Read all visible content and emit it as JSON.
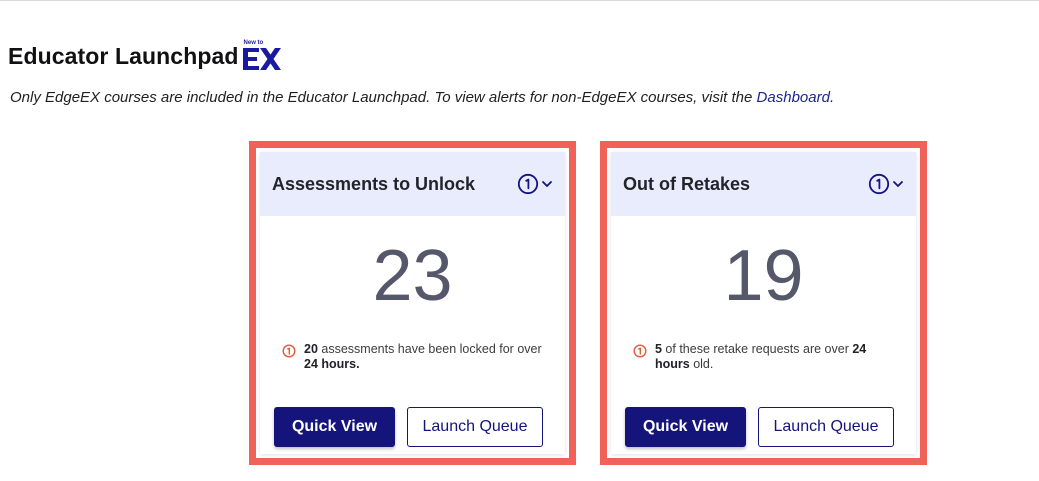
{
  "header": {
    "title": "Educator Launchpad",
    "logo": {
      "tag": "New to",
      "text": "EX",
      "color": "#1a1aa0",
      "icon": "edge-ex-logo-icon"
    }
  },
  "intro": {
    "text_before": "Only EdgeEX courses are included in the Educator Launchpad. To view alerts for non-EdgeEX courses, visit the ",
    "link_label": "Dashboard",
    "text_after": "."
  },
  "cards": [
    {
      "title": "Assessments to Unlock",
      "count": "23",
      "alert": {
        "highlight_count": "20",
        "text_mid": " assessments have been locked for over ",
        "highlight_time": "24 hours.",
        "text_end": ""
      },
      "primary_label": "Quick View",
      "secondary_label": "Launch Queue"
    },
    {
      "title": "Out of Retakes",
      "count": "19",
      "alert": {
        "highlight_count": "5",
        "text_mid": " of these retake requests are over ",
        "highlight_time": "24 hours",
        "text_end": " old."
      },
      "primary_label": "Quick View",
      "secondary_label": "Launch Queue"
    }
  ],
  "colors": {
    "highlight_frame": "#f0615a",
    "header_bg": "#e9ecfd",
    "primary": "#14147a",
    "alert_icon": "#e05a3a",
    "link": "#1b2790"
  }
}
